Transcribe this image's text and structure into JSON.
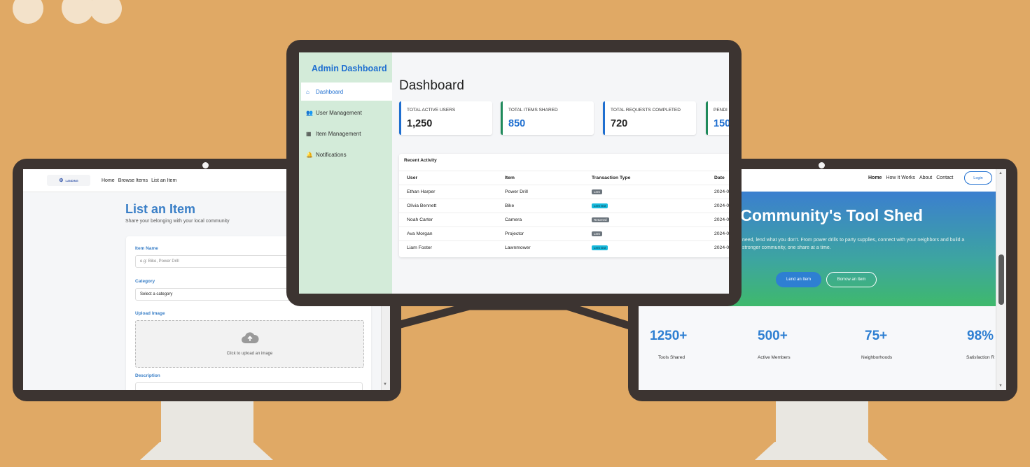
{
  "left_screen": {
    "logo_text": "LANDING",
    "nav": [
      "Home",
      "Browse Items",
      "List an Item"
    ],
    "title": "List an Item",
    "subtitle": "Share your belonging with your local community",
    "fields": {
      "item_name_label": "Item Name",
      "item_name_placeholder": "e.g: Bike, Power Drill",
      "category_label": "Category",
      "category_value": "Select a category",
      "upload_label": "Upload Image",
      "upload_hint": "Click to upload an image",
      "description_label": "Description"
    }
  },
  "center_screen": {
    "brand": "Admin Dashboard",
    "sidebar": [
      {
        "label": "Dashboard",
        "icon": "home-icon"
      },
      {
        "label": "User Management",
        "icon": "users-icon"
      },
      {
        "label": "Item Management",
        "icon": "boxes-icon"
      },
      {
        "label": "Notifications",
        "icon": "bell-icon"
      }
    ],
    "page_title": "Dashboard",
    "stats": [
      {
        "label": "TOTAL ACTIVE USERS",
        "value": "1,250"
      },
      {
        "label": "TOTAL ITEMS SHARED",
        "value": "850"
      },
      {
        "label": "TOTAL REQUESTS COMPLETED",
        "value": "720"
      },
      {
        "label": "PENDI",
        "value": "150"
      }
    ],
    "recent_activity": {
      "title": "Recent Activity",
      "columns": [
        "User",
        "Item",
        "Transaction Type",
        "Date"
      ],
      "rows": [
        {
          "user": "Ethan Harper",
          "item": "Power Drill",
          "type": "Lent",
          "date": "2024-0"
        },
        {
          "user": "Olivia Bennett",
          "item": "Bike",
          "type": "Lent Out",
          "date": "2024-0"
        },
        {
          "user": "Noah Carter",
          "item": "Camera",
          "type": "Returned",
          "date": "2024-0"
        },
        {
          "user": "Ava Morgan",
          "item": "Projector",
          "type": "Lent",
          "date": "2024-0"
        },
        {
          "user": "Liam Foster",
          "item": "Lawnmower",
          "type": "Lent Out",
          "date": "2024-0"
        }
      ]
    }
  },
  "right_screen": {
    "nav": [
      "Home",
      "How It Works",
      "About",
      "Contact"
    ],
    "login": "Login",
    "hero_title": "r Community's Tool Shed",
    "hero_text": "need, lend what you don't. From power drills to party supplies, connect with your neighbors and build a stronger community, one share at a time.",
    "lend_button": "Lend an Item",
    "borrow_button": "Borrow an Item",
    "stats": [
      {
        "number": "1250+",
        "caption": "Tools Shared"
      },
      {
        "number": "500+",
        "caption": "Active Members"
      },
      {
        "number": "75+",
        "caption": "Neighborhoods"
      },
      {
        "number": "98%",
        "caption": "Satisfaction R"
      }
    ]
  },
  "colors": {
    "background": "#E0A965",
    "monitor_frame": "#3C3431",
    "accent_blue": "#1F6FD0",
    "sidebar_green": "#D3EBD9",
    "badge_lent": "#6C757D",
    "badge_lent_out": "#17B9DC"
  }
}
